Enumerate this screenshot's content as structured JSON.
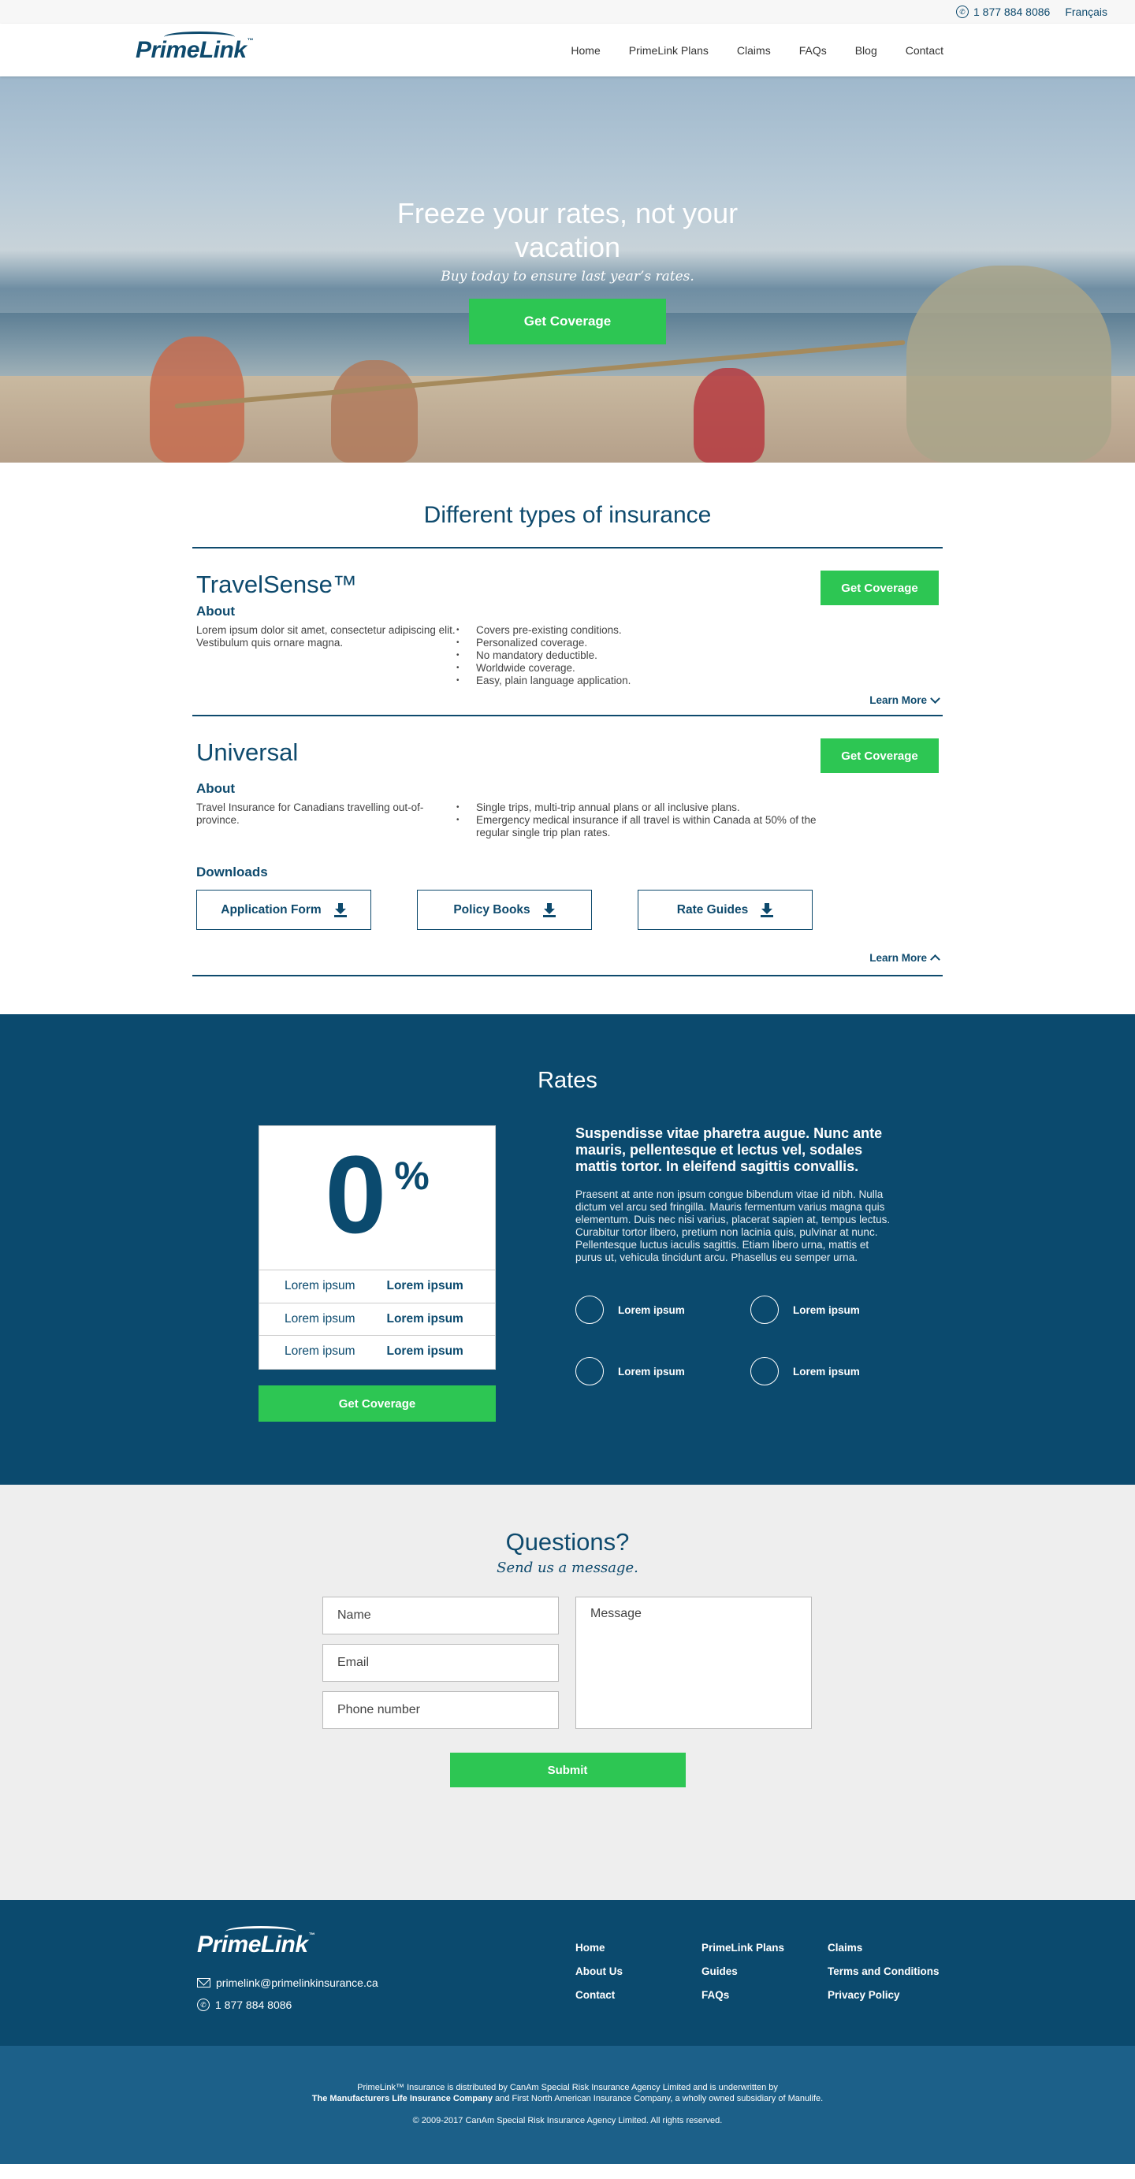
{
  "topbar": {
    "phone": "1 877 884 8086",
    "language": "Français"
  },
  "brand": {
    "name": "PrimeLink",
    "tm": "™"
  },
  "nav": [
    "Home",
    "PrimeLink Plans",
    "Claims",
    "FAQs",
    "Blog",
    "Contact"
  ],
  "hero": {
    "title": "Freeze your rates, not your vacation",
    "subtitle": "Buy today to ensure last year’s rates.",
    "cta": "Get Coverage"
  },
  "types": {
    "title": "Different types of insurance",
    "cards": [
      {
        "name": "TravelSense™",
        "cta": "Get Coverage",
        "about_label": "About",
        "about": "Lorem ipsum dolor sit amet, consectetur adipiscing elit. Vestibulum quis ornare magna.",
        "bullets": [
          "Covers pre-existing conditions.",
          "Personalized coverage.",
          "No mandatory deductible.",
          "Worldwide coverage.",
          "Easy, plain language application."
        ],
        "learn_more": "Learn More"
      },
      {
        "name": "Universal",
        "cta": "Get Coverage",
        "about_label": "About",
        "about": "Travel Insurance for Canadians travelling out-of-province.",
        "bullets": [
          "Single trips, multi-trip annual plans or all inclusive plans.",
          "Emergency medical insurance if all travel is within Canada at 50% of the regular single trip plan rates."
        ],
        "downloads_label": "Downloads",
        "downloads": [
          "Application Form",
          "Policy Books",
          "Rate Guides"
        ],
        "learn_more": "Learn More"
      }
    ]
  },
  "rates": {
    "title": "Rates",
    "big_number": "0",
    "big_unit": "%",
    "rows": [
      {
        "label": "Lorem ipsum",
        "value": "Lorem ipsum"
      },
      {
        "label": "Lorem ipsum",
        "value": "Lorem ipsum"
      },
      {
        "label": "Lorem ipsum",
        "value": "Lorem ipsum"
      }
    ],
    "cta": "Get Coverage",
    "heading": "Suspendisse vitae pharetra augue. Nunc ante mauris, pellentesque et lectus vel, sodales mattis tortor. In eleifend sagittis convallis.",
    "body": "Praesent at ante non ipsum congue bibendum vitae id nibh. Nulla dictum vel arcu sed fringilla. Mauris fermentum varius magna quis elementum. Duis nec nisi varius, placerat sapien at, tempus lectus. Curabitur tortor libero, pretium non lacinia quis, pulvinar at nunc. Pellentesque luctus iaculis sagittis. Etiam libero urna, mattis et purus ut, vehicula tincidunt arcu. Phasellus eu semper urna.",
    "features": [
      "Lorem ipsum",
      "Lorem ipsum",
      "Lorem ipsum",
      "Lorem ipsum"
    ]
  },
  "questions": {
    "title": "Questions?",
    "subtitle": "Send us a message.",
    "name_placeholder": "Name",
    "email_placeholder": "Email",
    "phone_placeholder": "Phone number",
    "message_placeholder": "Message",
    "submit": "Submit"
  },
  "footer": {
    "email": "primelink@primelinkinsurance.ca",
    "phone": "1 877 884 8086",
    "links": [
      "Home",
      "PrimeLink Plans",
      "Claims",
      "About Us",
      "Guides",
      "Terms and Conditions",
      "Contact",
      "FAQs",
      "Privacy Policy"
    ],
    "legal_1": "PrimeLink™ Insurance is distributed by CanAm Special Risk Insurance Agency Limited and is underwritten by",
    "legal_2_bold": "The Manufacturers Life Insurance Company",
    "legal_2_rest": " and First North American Insurance Company, a wholly owned subsidiary of Manulife.",
    "copyright": "© 2009-2017 CanAm Special Risk Insurance Agency Limited. All rights reserved."
  },
  "colors": {
    "brand_blue": "#0b4a6e",
    "accent_green": "#2dc653",
    "footer_bottom": "#1c6089"
  }
}
